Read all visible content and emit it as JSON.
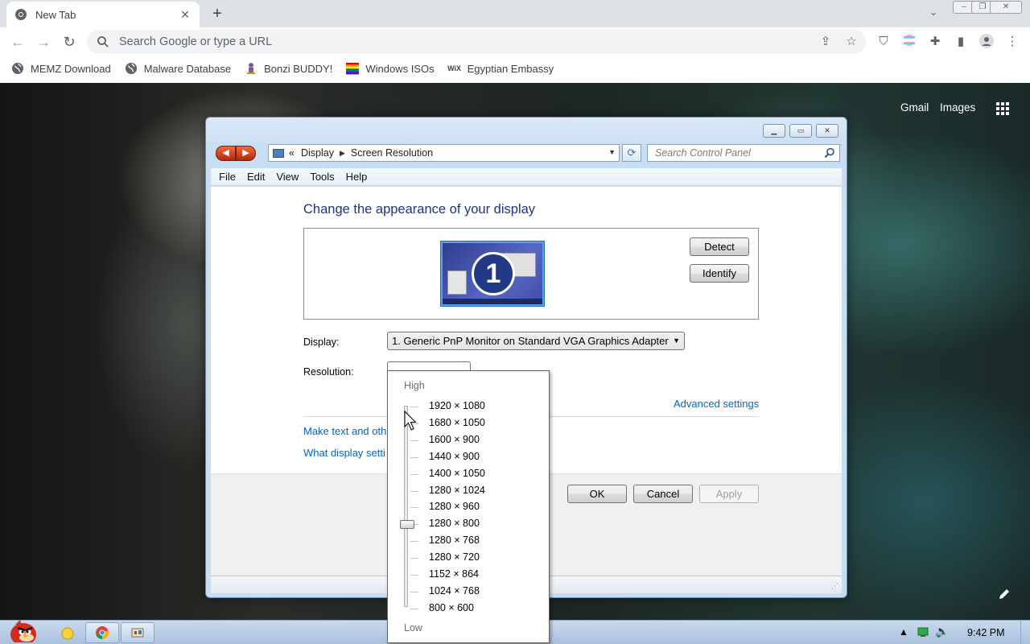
{
  "browser": {
    "tab_title": "New Tab",
    "omnibox_placeholder": "Search Google or type a URL",
    "bookmarks": [
      {
        "label": "MEMZ Download",
        "icon": "globe-icon"
      },
      {
        "label": "Malware Database",
        "icon": "globe-icon"
      },
      {
        "label": "Bonzi BUDDY!",
        "icon": "bonzi-icon"
      },
      {
        "label": "Windows ISOs",
        "icon": "rainbow-flag-icon"
      },
      {
        "label": "Egyptian Embassy",
        "icon": "wix-icon",
        "icon_text": "WiX"
      }
    ]
  },
  "google": {
    "gmail": "Gmail",
    "images": "Images"
  },
  "window": {
    "breadcrumb": [
      "Display",
      "Screen Resolution"
    ],
    "breadcrumb_prefix": "«",
    "search_placeholder": "Search Control Panel",
    "menu": [
      "File",
      "Edit",
      "View",
      "Tools",
      "Help"
    ],
    "title": "Change the appearance of your display",
    "monitor_number": "1",
    "detect": "Detect",
    "identify": "Identify",
    "display_label": "Display:",
    "display_value": "1. Generic PnP Monitor on Standard VGA Graphics Adapter",
    "resolution_label": "Resolution:",
    "advanced_settings": "Advanced settings",
    "link_text_size": "Make text and oth",
    "link_what_display": "What display setti",
    "ok": "OK",
    "cancel": "Cancel",
    "apply": "Apply"
  },
  "resolution_popup": {
    "high": "High",
    "low": "Low",
    "selected": "1280 × 800",
    "options": [
      "1920 × 1080",
      "1680 × 1050",
      "1600 × 900",
      "1440 × 900",
      "1400 × 1050",
      "1280 × 1024",
      "1280 × 960",
      "1280 × 800",
      "1280 × 768",
      "1280 × 720",
      "1152 × 864",
      "1024 × 768",
      "800 × 600"
    ]
  },
  "taskbar": {
    "clock": "9:42 PM"
  },
  "colors": {
    "title_blue": "#1e3287",
    "link_blue": "#0066cc",
    "chrome_tabstrip": "#dee1e6",
    "taskbar": "#b8cde4"
  }
}
